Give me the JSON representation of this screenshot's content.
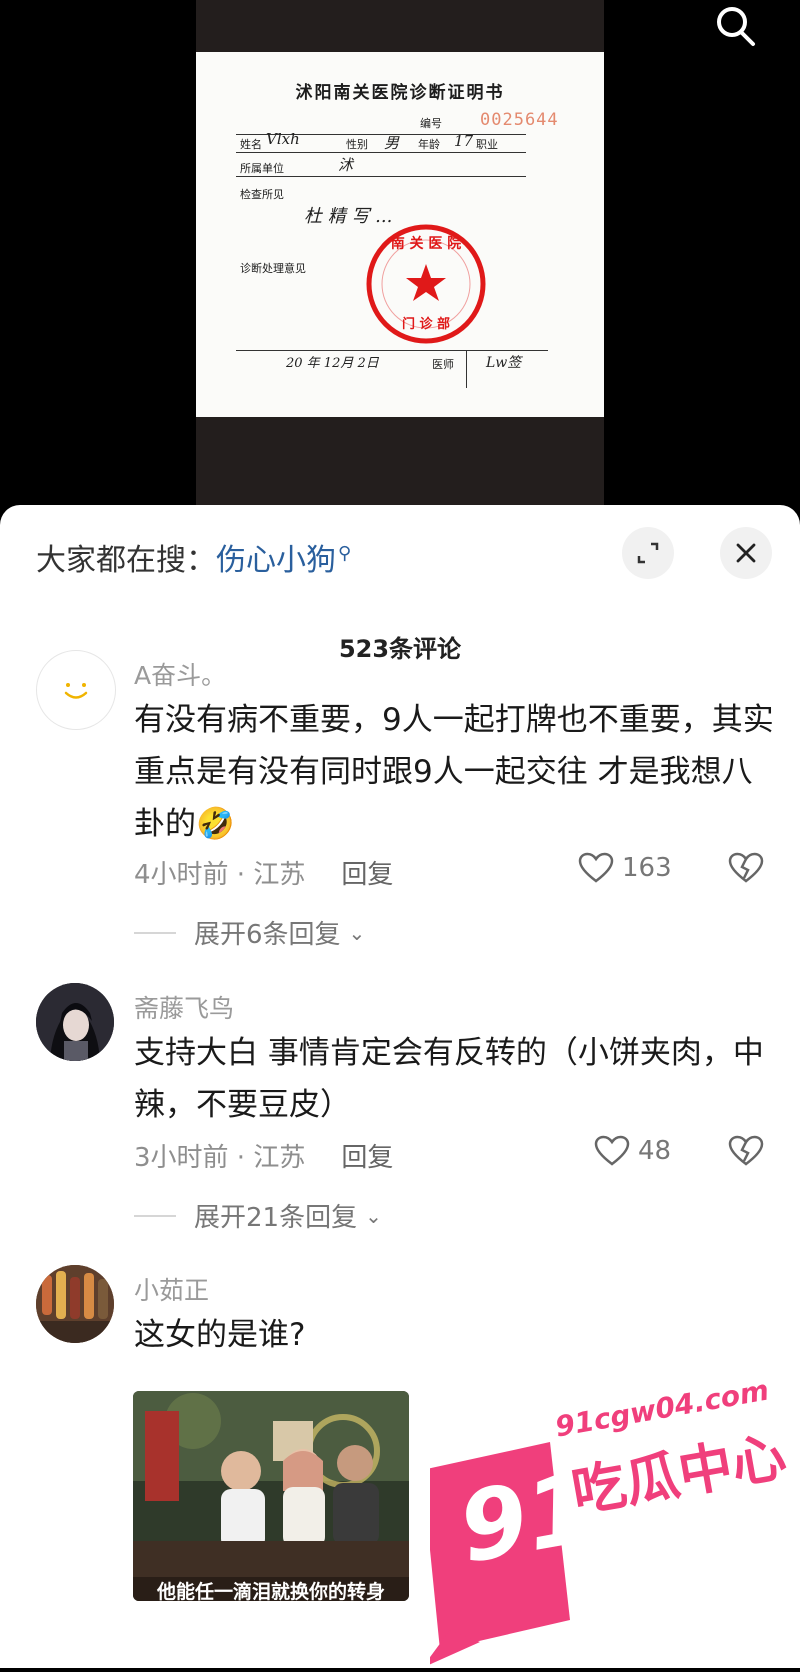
{
  "media": {
    "document": {
      "title": "沭阳南关医院诊断证明书",
      "number_label": "编号",
      "number": "0025644",
      "labels": {
        "name": "姓名",
        "gender": "性别",
        "age": "年龄",
        "occupation": "职业",
        "unit": "所属单位",
        "exam": "检查所见",
        "diagnosis": "诊断处理意见",
        "doctor": "医师"
      },
      "date_handwritten": "20 年 12月 2日",
      "stamp_text": "沭阳南关医院门诊部"
    },
    "search_icon": "search-icon"
  },
  "sheet": {
    "hot_search_label": "大家都在搜：",
    "hot_search_term": "伤心小狗",
    "comment_count": "523条评论",
    "comments": [
      {
        "username": "A奋斗。",
        "text": "有没有病不重要，9人一起打牌也不重要，其实重点是有没有同时跟9人一起交往 才是我想八卦的🤣",
        "time_location": "4小时前 · 江苏",
        "reply": "回复",
        "likes": "163",
        "expand": "展开6条回复"
      },
      {
        "username": "斋藤飞鸟",
        "text": "支持大白 事情肯定会有反转的（小饼夹肉，中辣，不要豆皮）",
        "time_location": "3小时前 · 江苏",
        "reply": "回复",
        "likes": "48",
        "expand": "展开21条回复"
      },
      {
        "username": "小茹正",
        "text": "这女的是谁?",
        "image_caption": "他能任一滴泪就换你的转身"
      }
    ]
  },
  "watermark": {
    "number": "91",
    "domain": "91cgw04.com",
    "brand": "吃瓜中心"
  },
  "colors": {
    "accent_link": "#2a5f9d",
    "watermark_pink": "#f03f7c",
    "stamp_red": "#e01919"
  }
}
